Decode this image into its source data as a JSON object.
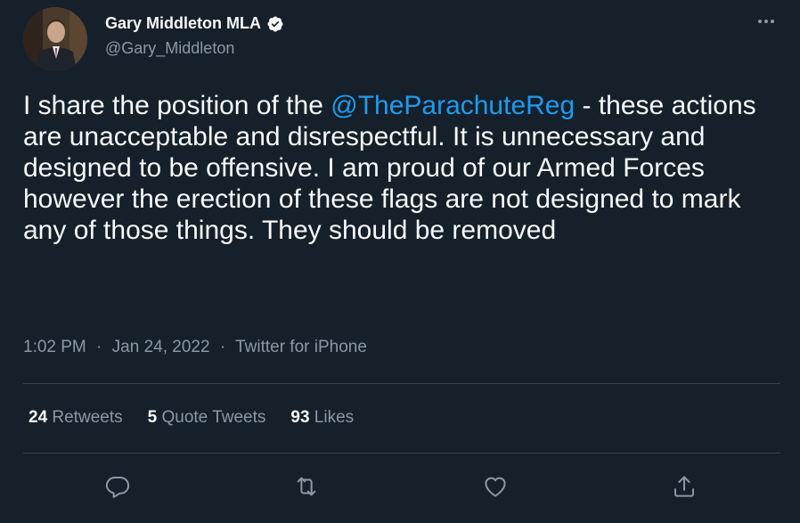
{
  "author": {
    "display_name": "Gary Middleton MLA",
    "handle": "@Gary_Middleton",
    "verified": true
  },
  "tweet": {
    "text_before": "I share the position of the ",
    "mention": "@TheParachuteReg",
    "text_after": " - these actions are unacceptable and disrespectful. It is unnecessary and designed to be offensive. I am proud of our Armed Forces however the erection of these flags are not designed to mark any of those things. They should be removed"
  },
  "meta": {
    "time": "1:02 PM",
    "separator": "·",
    "date": "Jan 24, 2022",
    "source": "Twitter for iPhone"
  },
  "stats": {
    "retweets_count": "24",
    "retweets_label": "Retweets",
    "quote_count": "5",
    "quote_label": "Quote Tweets",
    "likes_count": "93",
    "likes_label": "Likes"
  },
  "icons": {
    "more": "more-options-icon",
    "reply": "reply-icon",
    "retweet": "retweet-icon",
    "like": "like-icon",
    "share": "share-icon",
    "verified": "verified-badge-icon"
  },
  "colors": {
    "background": "#15202b",
    "text": "#f7f9f9",
    "secondary": "#8b98a5",
    "accent": "#1d9bf0",
    "divider": "#38444d"
  }
}
